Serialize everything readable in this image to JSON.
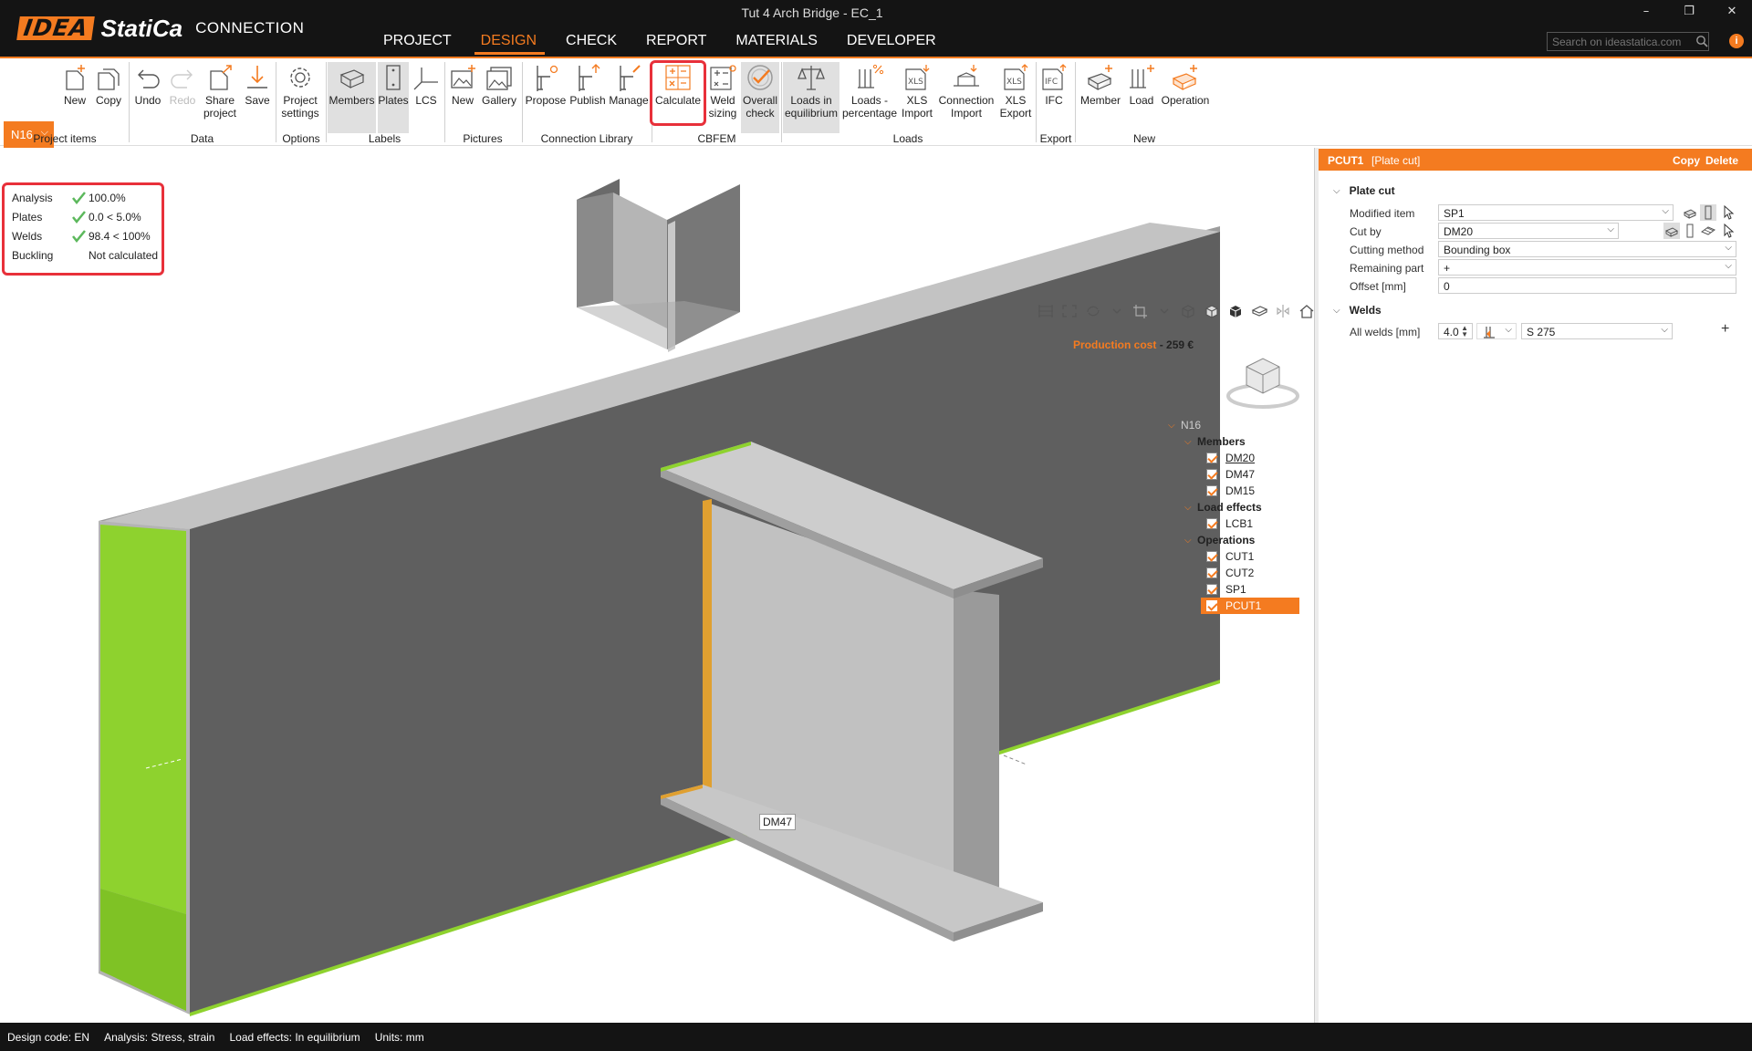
{
  "window": {
    "title": "Tut 4 Arch Bridge - EC_1",
    "minimize_glyph": "–",
    "restore_glyph": "❐",
    "close_glyph": "✕"
  },
  "brand": {
    "logo_idea": "IDEA",
    "logo_statica": "StatiCa",
    "product": "CONNECTION",
    "accent_color": "#f47b20"
  },
  "menu": {
    "items": [
      "PROJECT",
      "DESIGN",
      "CHECK",
      "REPORT",
      "MATERIALS",
      "DEVELOPER"
    ],
    "active": "DESIGN"
  },
  "search": {
    "placeholder": "Search on ideastatica.com",
    "info_glyph": "i"
  },
  "ribbon": {
    "connection_selector": "N16",
    "buttons": {
      "new": "New",
      "copy": "Copy",
      "undo": "Undo",
      "redo": "Redo",
      "share": "Share project",
      "save": "Save",
      "project_settings": "Project settings",
      "members": "Members",
      "plates": "Plates",
      "lcs": "LCS",
      "new_picture": "New",
      "gallery": "Gallery",
      "propose": "Propose",
      "publish": "Publish",
      "manage": "Manage",
      "calculate": "Calculate",
      "weld_sizing": "Weld sizing",
      "overall_check": "Overall check",
      "loads_in_equilibrium": "Loads in equilibrium",
      "loads_percentage": "Loads - percentage",
      "xls_import": "XLS Import",
      "connection_import": "Connection Import",
      "xls_export": "XLS Export",
      "ifc": "IFC",
      "new_member": "Member",
      "new_load": "Load",
      "new_operation": "Operation"
    },
    "groups": {
      "project_items": "Project items",
      "data": "Data",
      "options": "Options",
      "labels": "Labels",
      "pictures": "Pictures",
      "connection_library": "Connection Library",
      "cbfem": "CBFEM",
      "loads": "Loads",
      "export": "Export",
      "new": "New"
    }
  },
  "results": {
    "rows": [
      {
        "name": "Analysis",
        "value": "100.0%",
        "status": "ok"
      },
      {
        "name": "Plates",
        "value": "0.0 < 5.0%",
        "status": "ok"
      },
      {
        "name": "Welds",
        "value": "98.4 < 100%",
        "status": "ok"
      },
      {
        "name": "Buckling",
        "value": "Not calculated",
        "status": "none"
      }
    ],
    "ok_color": "#5cb85c"
  },
  "production_cost": {
    "label": "Production cost",
    "value": "- 259 €"
  },
  "tree": {
    "root": "N16",
    "members_label": "Members",
    "members": [
      "DM20",
      "DM47",
      "DM15"
    ],
    "load_effects_label": "Load effects",
    "load_effects": [
      "LCB1"
    ],
    "operations_label": "Operations",
    "operations": [
      "CUT1",
      "CUT2",
      "SP1",
      "PCUT1"
    ],
    "selected": "PCUT1"
  },
  "scene": {
    "member_label": "DM47",
    "plate_color": "#606060",
    "steel_light": "#c4c4c4",
    "weld_color": "#8ed22e"
  },
  "panel": {
    "title": "PCUT1",
    "type": "[Plate cut]",
    "copy": "Copy",
    "delete": "Delete",
    "plate_cut": {
      "section": "Plate cut",
      "modified_item_label": "Modified item",
      "modified_item": "SP1",
      "cut_by_label": "Cut by",
      "cut_by": "DM20",
      "cutting_method_label": "Cutting method",
      "cutting_method": "Bounding box",
      "remaining_part_label": "Remaining part",
      "remaining_part": "+",
      "offset_label": "Offset [mm]",
      "offset": "0"
    },
    "welds": {
      "section": "Welds",
      "all_welds_label": "All welds [mm]",
      "size": "4.0",
      "material": "S 275",
      "add_glyph": "+"
    }
  },
  "status": {
    "design_code_label": "Design code:",
    "design_code": "EN",
    "analysis_label": "Analysis:",
    "analysis": "Stress, strain",
    "load_effects_label": "Load effects:",
    "load_effects": "In equilibrium",
    "units_label": "Units:",
    "units": "mm"
  }
}
